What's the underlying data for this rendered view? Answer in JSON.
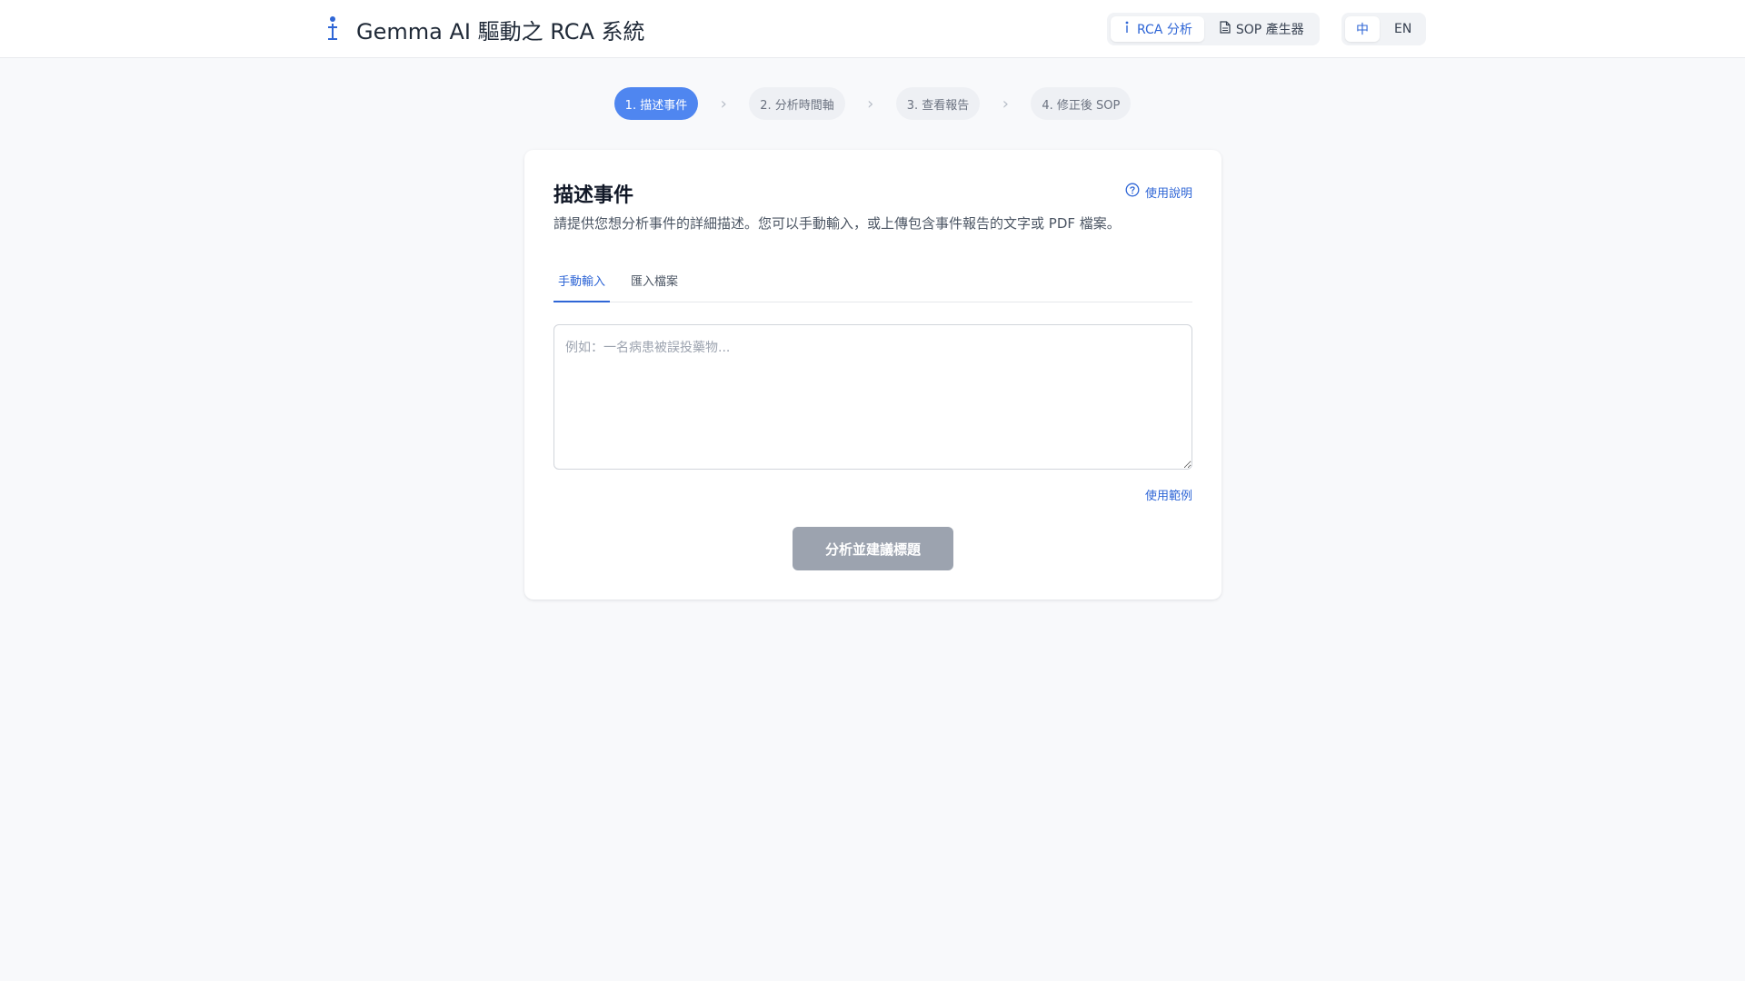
{
  "header": {
    "title": "Gemma AI 驅動之 RCA 系統",
    "logo_icon": "info-pin-icon",
    "modes": [
      {
        "label": "RCA 分析",
        "icon": "info-icon",
        "active": true
      },
      {
        "label": "SOP 產生器",
        "icon": "document-icon",
        "active": false
      }
    ],
    "languages": [
      {
        "label": "中",
        "active": true
      },
      {
        "label": "EN",
        "active": false
      }
    ]
  },
  "steps": [
    {
      "label": "1. 描述事件",
      "active": true
    },
    {
      "label": "2. 分析時間軸",
      "active": false
    },
    {
      "label": "3. 查看報告",
      "active": false
    },
    {
      "label": "4. 修正後 SOP",
      "active": false
    }
  ],
  "card": {
    "title": "描述事件",
    "help_label": "使用說明",
    "description": "請提供您想分析事件的詳細描述。您可以手動輸入，或上傳包含事件報告的文字或 PDF 檔案。",
    "tabs": [
      {
        "label": "手動輸入",
        "active": true
      },
      {
        "label": "匯入檔案",
        "active": false
      }
    ],
    "input": {
      "value": "",
      "placeholder": "例如：一名病患被誤投藥物..."
    },
    "examples_label": "使用範例",
    "submit_label": "分析並建議標題"
  },
  "colors": {
    "accent": "#2f66d6",
    "step_active": "#4f86f0",
    "button_disabled": "#9ca3af"
  }
}
